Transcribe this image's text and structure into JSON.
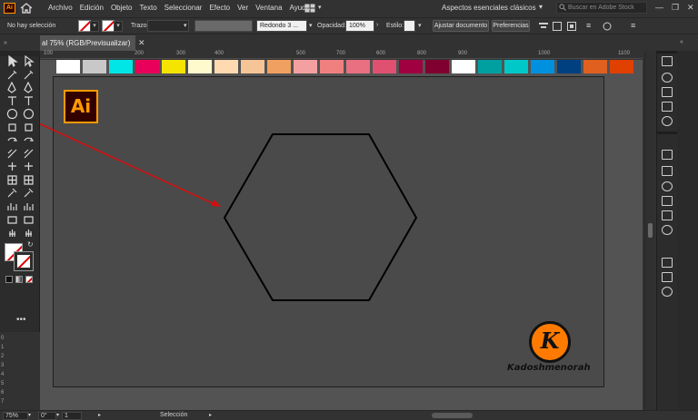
{
  "app": {
    "logo_text": "Ai",
    "menu": [
      "Archivo",
      "Edición",
      "Objeto",
      "Texto",
      "Seleccionar",
      "Efecto",
      "Ver",
      "Ventana",
      "Ayuda"
    ],
    "workspace": "Aspectos esenciales clásicos",
    "search_placeholder": "Buscar en Adobe Stock"
  },
  "control": {
    "selection": "No hay selección",
    "stroke_label": "Trazo:",
    "brush": "Redondo 3 ...",
    "opacity_label": "Opacidad:",
    "opacity_value": "100%",
    "style_label": "Estilo:",
    "adjust_button": "Ajustar documento",
    "prefs_button": "Preferencias"
  },
  "document": {
    "tab_label": "al 75% (RGB/Previsualizar)",
    "close": "✕"
  },
  "ruler": {
    "top_ticks": [
      "100",
      "200",
      "300",
      "400",
      "500",
      "600",
      "700",
      "800",
      "900",
      "1000",
      "1100"
    ],
    "left_ticks": [
      "0",
      "1",
      "2",
      "3",
      "4",
      "5",
      "6",
      "7"
    ]
  },
  "palette": [
    "#ffffff",
    "#c8c8c8",
    "#00e5e5",
    "#e8005a",
    "#f5e400",
    "#fffacd",
    "#ffd9b0",
    "#f5c497",
    "#f0a060",
    "#f5a0a0",
    "#f08080",
    "#e87080",
    "#e05070",
    "#a00040",
    "#800030",
    "#ffffff",
    "#00a0a0",
    "#00c8c8",
    "#0090e0",
    "#004080",
    "#e06020",
    "#e04000"
  ],
  "canvas": {
    "ai_badge": "Ai",
    "watermark_letter": "K",
    "watermark_name": "Kadoshmenorah"
  },
  "status": {
    "zoom": "75%",
    "rotation": "0°",
    "artboard": "1",
    "tool": "Selección"
  },
  "colors": {
    "accent": "#ff9a00",
    "annotation": "#d01010"
  }
}
